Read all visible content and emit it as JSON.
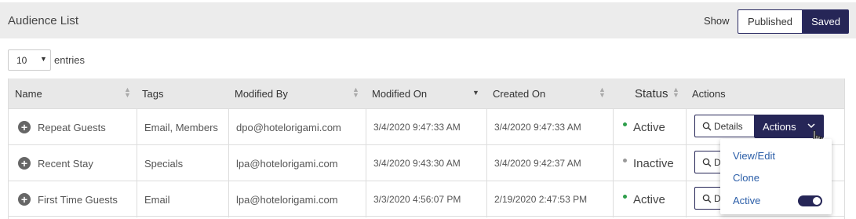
{
  "header": {
    "title": "Audience List",
    "show_label": "Show",
    "toggle": {
      "published": "Published",
      "saved": "Saved"
    }
  },
  "length_menu": {
    "value": "10",
    "label": "entries"
  },
  "table": {
    "columns": [
      "Name",
      "Tags",
      "Modified By",
      "Modified On",
      "Created On",
      "Status",
      "Actions"
    ],
    "rows": [
      {
        "name": "Repeat Guests",
        "tags": "Email, Members",
        "modified_by": "dpo@hotelorigami.com",
        "modified_on": "3/4/2020 9:47:33 AM",
        "created_on": "3/4/2020 9:47:33 AM",
        "status": "Active",
        "details": "Details"
      },
      {
        "name": "Recent Stay",
        "tags": "Specials",
        "modified_by": "lpa@hotelorigami.com",
        "modified_on": "3/4/2020 9:43:30 AM",
        "created_on": "3/4/2020 9:42:37 AM",
        "status": "Inactive",
        "details": "D"
      },
      {
        "name": "First Time Guests",
        "tags": "Email",
        "modified_by": "lpa@hotelorigami.com",
        "modified_on": "3/3/2020 4:56:07 PM",
        "created_on": "2/19/2020 2:47:53 PM",
        "status": "Active",
        "details": "D"
      }
    ]
  },
  "actions_button": {
    "label": "Actions"
  },
  "dropdown": {
    "view_edit": "View/Edit",
    "clone": "Clone",
    "active": "Active"
  },
  "colors": {
    "primary": "#262657",
    "link": "#2b5ea8",
    "active": "#2e9e4b",
    "inactive": "#999999"
  }
}
